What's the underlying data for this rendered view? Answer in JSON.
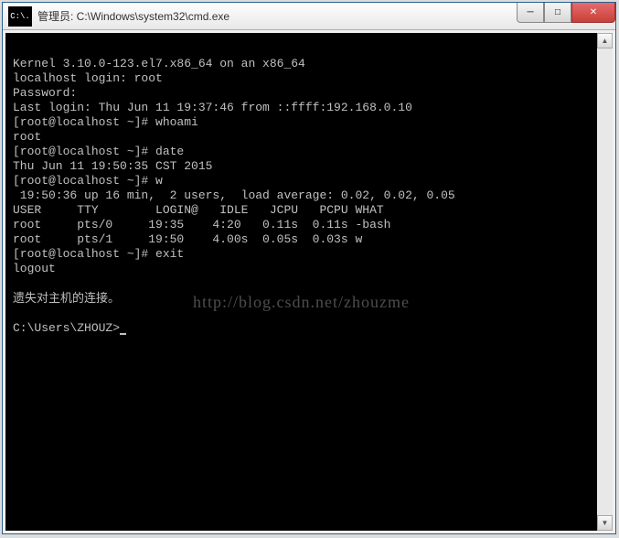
{
  "window": {
    "icon_text": "C:\\.",
    "title": "管理员: C:\\Windows\\system32\\cmd.exe"
  },
  "win_buttons": {
    "min_glyph": "─",
    "max_glyph": "□",
    "close_glyph": "✕"
  },
  "terminal": {
    "lines": {
      "l0": "Kernel 3.10.0-123.el7.x86_64 on an x86_64",
      "l1": "localhost login: root",
      "l2": "Password:",
      "l3": "Last login: Thu Jun 11 19:37:46 from ::ffff:192.168.0.10",
      "l4": "[root@localhost ~]# whoami",
      "l5": "root",
      "l6": "[root@localhost ~]# date",
      "l7": "Thu Jun 11 19:50:35 CST 2015",
      "l8": "[root@localhost ~]# w",
      "l9": " 19:50:36 up 16 min,  2 users,  load average: 0.02, 0.02, 0.05",
      "l10": "USER     TTY        LOGIN@   IDLE   JCPU   PCPU WHAT",
      "l11": "root     pts/0     19:35    4:20   0.11s  0.11s -bash",
      "l12": "root     pts/1     19:50    4.00s  0.05s  0.03s w",
      "l13": "[root@localhost ~]# exit",
      "l14": "logout",
      "blank": "",
      "lost": "遗失对主机的连接。",
      "prompt": "C:\\Users\\ZHOUZ>"
    }
  },
  "watermark": "http://blog.csdn.net/zhouzme",
  "scrollbar": {
    "up": "▲",
    "down": "▼"
  }
}
